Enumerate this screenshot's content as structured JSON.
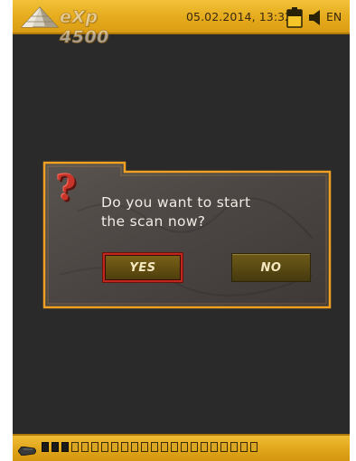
{
  "status_bar": {
    "logo_text": "eXp 4500",
    "datetime": "05.02.2014, 13:32",
    "language": "EN",
    "battery_icon": "battery-icon",
    "speaker_icon": "speaker-icon"
  },
  "dialog": {
    "icon": "question-mark-icon",
    "icon_glyph": "?",
    "message": "Do you want to start\nthe scan now?",
    "yes_label": "YES",
    "no_label": "NO",
    "selected": "YES"
  },
  "bottom_bar": {
    "probe_icon": "probe-icon",
    "signal_segments_total": 22,
    "signal_segments_active": 3
  },
  "colors": {
    "accent_gold": "#e7ad1f",
    "background": "#2a2a2a",
    "dialog_border": "#f0a020",
    "selected_border": "#c0281e",
    "question_mark": "#c8342a"
  }
}
